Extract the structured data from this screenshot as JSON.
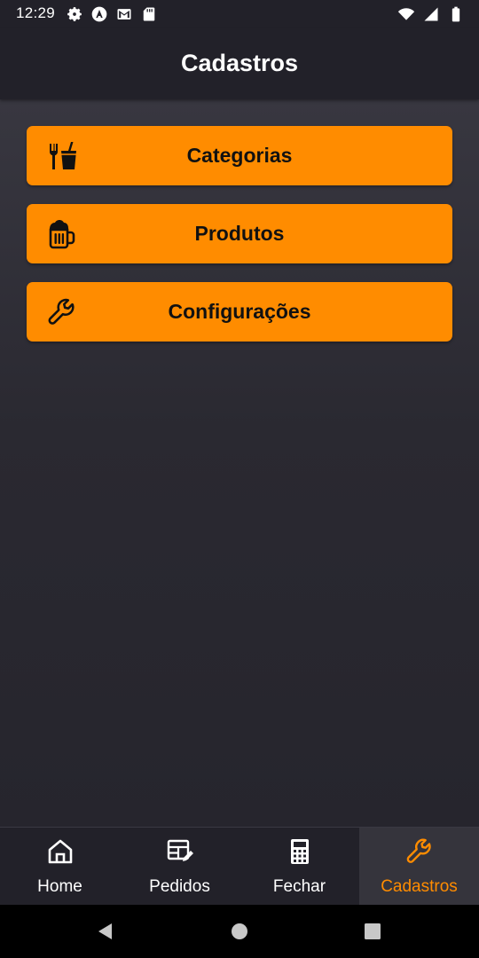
{
  "status_bar": {
    "time": "12:29",
    "left_icons": [
      "settings-icon",
      "app-a-icon",
      "gmail-icon",
      "sd-card-icon"
    ],
    "right_icons": [
      "wifi-icon",
      "signal-icon",
      "battery-icon"
    ]
  },
  "header": {
    "title": "Cadastros"
  },
  "menu": {
    "items": [
      {
        "label": "Categorias",
        "icon": "utensils-drink-icon"
      },
      {
        "label": "Produtos",
        "icon": "beer-mug-icon"
      },
      {
        "label": "Configurações",
        "icon": "wrench-icon"
      }
    ]
  },
  "bottom_nav": {
    "items": [
      {
        "label": "Home",
        "icon": "home-icon",
        "active": false
      },
      {
        "label": "Pedidos",
        "icon": "edit-list-icon",
        "active": false
      },
      {
        "label": "Fechar",
        "icon": "calculator-icon",
        "active": false
      },
      {
        "label": "Cadastros",
        "icon": "wrench-icon",
        "active": true
      }
    ]
  },
  "colors": {
    "accent": "#ff8c00",
    "background": "#222129",
    "text": "#ffffff"
  },
  "system_nav": [
    "back-icon",
    "home-circle-icon",
    "recents-icon"
  ]
}
